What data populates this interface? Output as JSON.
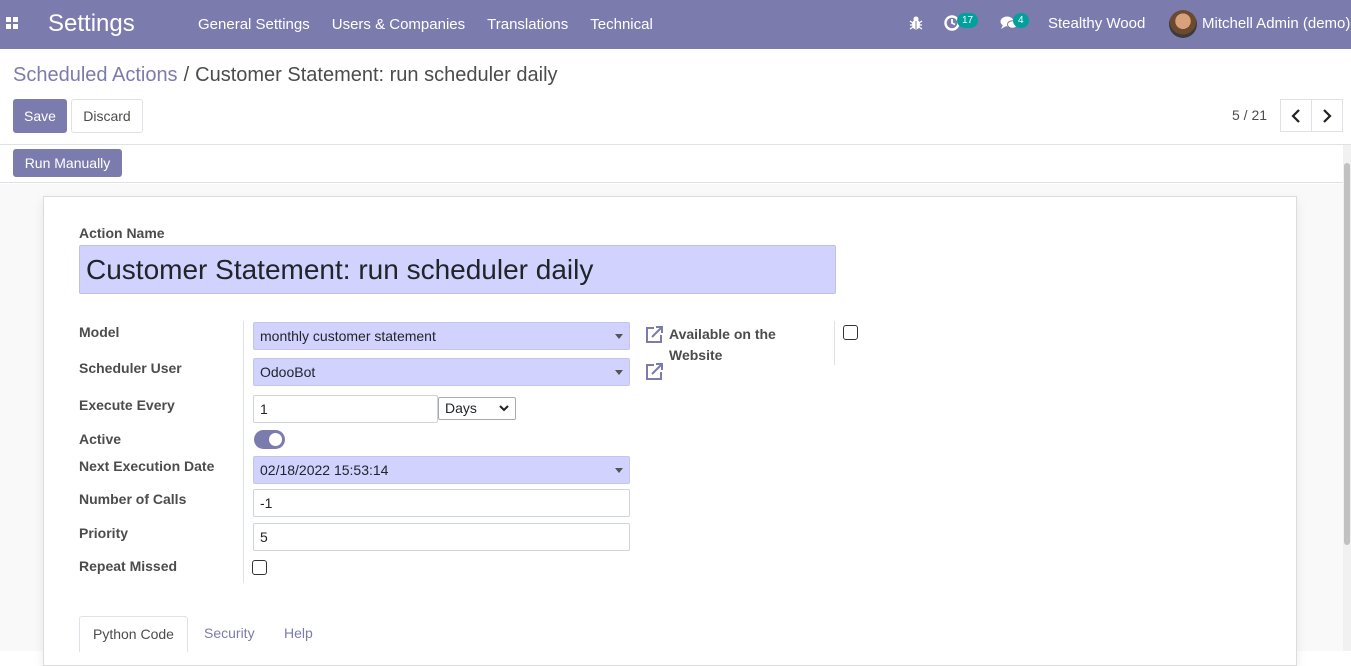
{
  "navbar": {
    "app_title": "Settings",
    "menu": [
      "General Settings",
      "Users & Companies",
      "Translations",
      "Technical"
    ],
    "activity_badge": "17",
    "messages_badge": "4",
    "company": "Stealthy Wood",
    "user": "Mitchell Admin (demo)",
    "icons": [
      "apps-grid-icon",
      "bug-icon",
      "activity-clock-icon",
      "chat-icon",
      "avatar"
    ]
  },
  "breadcrumb": {
    "parent": "Scheduled Actions",
    "separator": "/",
    "current": "Customer Statement: run scheduler daily"
  },
  "buttons": {
    "save": "Save",
    "discard": "Discard",
    "run_manually": "Run Manually"
  },
  "pager": {
    "value": "5 / 21"
  },
  "form": {
    "action_name_label": "Action Name",
    "action_name": "Customer Statement: run scheduler daily",
    "model_label": "Model",
    "model": "monthly customer statement",
    "scheduler_user_label": "Scheduler User",
    "scheduler_user": "OdooBot",
    "execute_every_label": "Execute Every",
    "execute_every": "1",
    "interval_unit": "Days",
    "active_label": "Active",
    "active": true,
    "next_execution_label": "Next Execution Date",
    "next_execution": "02/18/2022 15:53:14",
    "number_of_calls_label": "Number of Calls",
    "number_of_calls": "-1",
    "priority_label": "Priority",
    "priority": "5",
    "repeat_missed_label": "Repeat Missed",
    "repeat_missed": false,
    "available_website_label_1": "Available on the",
    "available_website_label_2": "Website",
    "available_website": false
  },
  "tabs": [
    "Python Code",
    "Security",
    "Help"
  ],
  "colors": {
    "brand": "#7c7bad",
    "required_field": "#d2d2ff",
    "badge": "#00a09d"
  }
}
